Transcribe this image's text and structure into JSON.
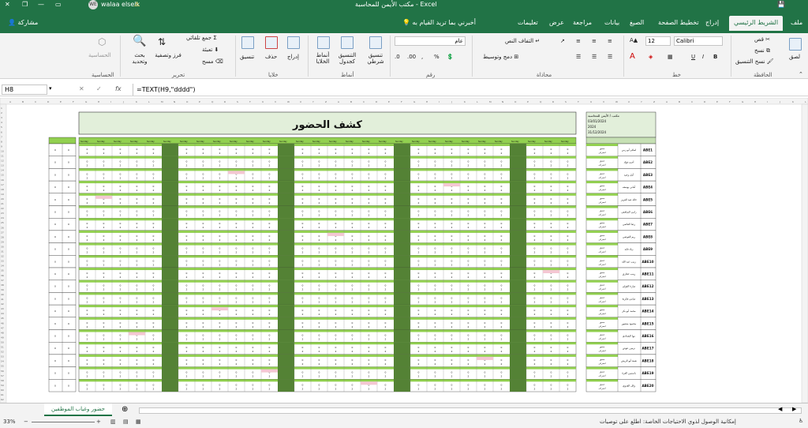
{
  "titlebar": {
    "doc_title": "مكتب الأيمن للمحاسبة - Excel",
    "user": "walaa elselk",
    "user_initials": "WE"
  },
  "tabs": [
    "ملف",
    "الشريط الرئيسي",
    "إدراج",
    "تخطيط الصفحة",
    "الصيغ",
    "بيانات",
    "مراجعة",
    "عرض",
    "تعليمات"
  ],
  "tellme": "أخبرني بما تريد القيام به",
  "share": "مشاركة",
  "ribbon": {
    "clipboard": {
      "paste": "لصق",
      "cut": "قص",
      "copy": "نسخ",
      "format_painter": "نسخ التنسيق",
      "group": "الحافظة"
    },
    "font": {
      "name": "Calibri",
      "size": "12",
      "bold": "B",
      "italic": "I",
      "underline": "U",
      "group": "خط"
    },
    "alignment": {
      "wrap": "التفاف النص",
      "merge": "دمج وتوسيط",
      "group": "محاذاة"
    },
    "number": {
      "format": "عام",
      "group": "رقم"
    },
    "styles": {
      "cond": "تنسيق شرطي",
      "table": "التنسيق كجدول",
      "cell": "أنماط الخلايا",
      "group": "أنماط"
    },
    "cells": {
      "insert": "إدراج",
      "delete": "حذف",
      "format": "تنسيق",
      "group": "خلايا"
    },
    "editing": {
      "autosum": "جمع تلقائي",
      "fill": "تعبئة",
      "clear": "مسح",
      "sort": "فرز وتصفية",
      "find": "بحث وتحديد",
      "group": "تحرير"
    },
    "sensitivity": {
      "label": "الحساسية",
      "group": "الحساسية"
    }
  },
  "formula": {
    "namebox": "H8",
    "fx": "fx",
    "formula": "=TEXT(H9,\"dddd\")"
  },
  "sheet": {
    "title": "كشف الحضور",
    "info": [
      "مكتب / الأيمن للمحاسبة",
      "03/01/2024",
      "2024",
      "31/12/2024"
    ],
    "employees": [
      {
        "code": "ABE1",
        "name": "اسلام أبو زمن"
      },
      {
        "code": "ABE2",
        "name": "أحمد فؤاد"
      },
      {
        "code": "ABE3",
        "name": "أمل وحيد"
      },
      {
        "code": "ABE4",
        "name": "أماني يوسف"
      },
      {
        "code": "ABE5",
        "name": "خالد عبد العزيز"
      },
      {
        "code": "ABE6",
        "name": "رامي الشافعي"
      },
      {
        "code": "ABE7",
        "name": "رضا القاضي"
      },
      {
        "code": "ABE8",
        "name": "ريم العوضي"
      },
      {
        "code": "ABE9",
        "name": "زياد فايد"
      },
      {
        "code": "ABE10",
        "name": "زينب عبد الله"
      },
      {
        "code": "ABE11",
        "name": "زينب حجازي"
      },
      {
        "code": "ABE12",
        "name": "سارة الغولي"
      },
      {
        "code": "ABE13",
        "name": "سامي فكرية"
      },
      {
        "code": "ABE14",
        "name": "محمد أبو بكر"
      },
      {
        "code": "ABE15",
        "name": "محمود منصور"
      },
      {
        "code": "ABE16",
        "name": "مها البغدادي"
      },
      {
        "code": "ABE17",
        "name": "نرمين عوض"
      },
      {
        "code": "ABE18",
        "name": "نعمة أبو الريش"
      },
      {
        "code": "ABE19",
        "name": "ياسمين العزة"
      },
      {
        "code": "ABE20",
        "name": "وائل العدوي"
      }
    ],
    "row_label_present": "حضور",
    "row_label_absent": "انصراف",
    "tab_name": "حضور وغياب الموظفين"
  },
  "status": {
    "zoom": "33%",
    "accessibility": "إمكانية الوصول لذوي الاحتياجات الخاصة: اطلع على توصيات"
  },
  "colors": {
    "excel_green": "#217346",
    "header_green": "#c6e0b4",
    "dark_col": "#548235",
    "band": "#92d050",
    "pink": "#f4c7d3"
  }
}
